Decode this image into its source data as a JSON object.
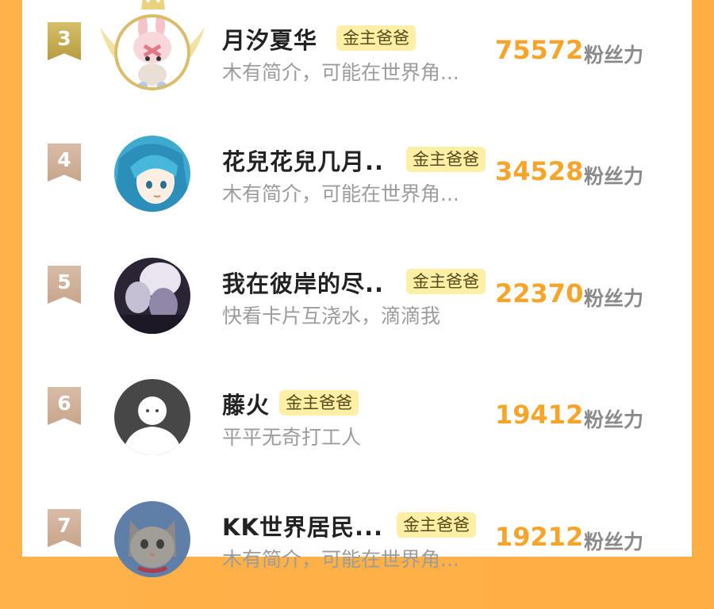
{
  "rows": [
    {
      "rank": "3",
      "name": "月汐夏华",
      "badge": "金主爸爸",
      "bio": "木有简介，可能在世界角...",
      "score": "75572",
      "unit": "粉丝力",
      "avatar_icon": "chopper-character-avatar",
      "frame": "gold"
    },
    {
      "rank": "4",
      "name": "花兒花兒几月..",
      "badge": "金主爸爸",
      "bio": "木有简介，可能在世界角...",
      "score": "34528",
      "unit": "粉丝力",
      "avatar_icon": "anime-girl-blue-hair-avatar",
      "frame": "none"
    },
    {
      "rank": "5",
      "name": "我在彼岸的尽..",
      "badge": "金主爸爸",
      "bio": "快看卡片互浇水，滴滴我",
      "score": "22370",
      "unit": "粉丝力",
      "avatar_icon": "anime-group-avatar",
      "frame": "none"
    },
    {
      "rank": "6",
      "name": "藤火",
      "badge": "金主爸爸",
      "bio": "平平无奇打工人",
      "score": "19412",
      "unit": "粉丝力",
      "avatar_icon": "default-person-avatar",
      "frame": "none"
    },
    {
      "rank": "7",
      "name": "KK世界居民...",
      "badge": "金主爸爸",
      "bio": "木有简介，可能在世界角...",
      "score": "19212",
      "unit": "粉丝力",
      "avatar_icon": "cat-avatar",
      "frame": "none"
    }
  ],
  "colors": {
    "accent_orange": "#f7a52a",
    "badge_bg": "#fdefa5",
    "gold": "#c9ad52",
    "bronze": "#c8a58c",
    "background": "#ffb24a"
  }
}
